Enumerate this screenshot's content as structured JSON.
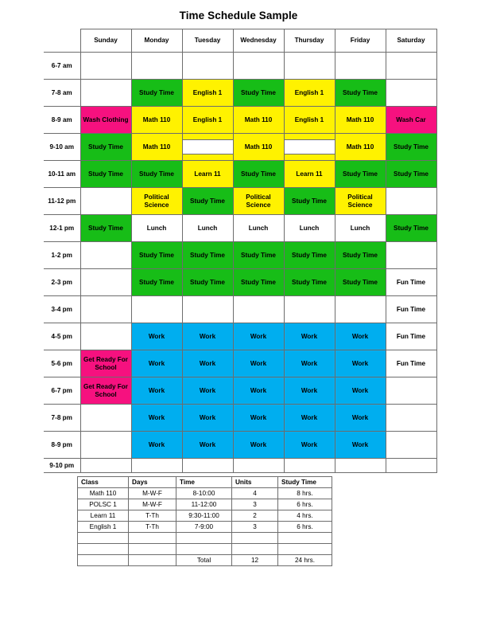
{
  "document": {
    "title": "Time Schedule Sample"
  },
  "colors": {
    "green": "#17bd17",
    "yellow": "#fff200",
    "pink": "#f6117f",
    "blue": "#00aeef",
    "white": "#ffffff",
    "border": "#6d6d6d"
  },
  "schedule": {
    "corner_label": "",
    "day_headers": [
      "Sunday",
      "Monday",
      "Tuesday",
      "Wednesday",
      "Thursday",
      "Friday",
      "Saturday"
    ],
    "time_labels": [
      "6-7 am",
      "7-8 am",
      "8-9 am",
      "9-10 am",
      "10-11 am",
      "11-12 pm",
      "12-1 pm",
      "1-2 pm",
      "2-3 pm",
      "3-4 pm",
      "4-5 pm",
      "5-6 pm",
      "6-7 pm",
      "7-8 pm",
      "8-9 pm",
      "9-10 pm"
    ],
    "rows": [
      {
        "time": "6-7 am",
        "cells": [
          {
            "text": "",
            "color": "white"
          },
          {
            "text": "",
            "color": "white"
          },
          {
            "text": "",
            "color": "white"
          },
          {
            "text": "",
            "color": "white"
          },
          {
            "text": "",
            "color": "white"
          },
          {
            "text": "",
            "color": "white"
          },
          {
            "text": "",
            "color": "white"
          }
        ]
      },
      {
        "time": "7-8 am",
        "cells": [
          {
            "text": "",
            "color": "white"
          },
          {
            "text": "Study Time",
            "color": "green"
          },
          {
            "text": "English 1",
            "color": "yellow"
          },
          {
            "text": "Study Time",
            "color": "green"
          },
          {
            "text": "English 1",
            "color": "yellow"
          },
          {
            "text": "Study Time",
            "color": "green"
          },
          {
            "text": "",
            "color": "white"
          }
        ]
      },
      {
        "time": "8-9 am",
        "cells": [
          {
            "text": "Wash Clothing",
            "color": "pink"
          },
          {
            "text": "Math 110",
            "color": "yellow"
          },
          {
            "text": "English 1",
            "color": "yellow"
          },
          {
            "text": "Math 110",
            "color": "yellow"
          },
          {
            "text": "English 1",
            "color": "yellow"
          },
          {
            "text": "Math 110",
            "color": "yellow"
          },
          {
            "text": "Wash Car",
            "color": "pink"
          }
        ]
      },
      {
        "time": "9-10 am",
        "cells": [
          {
            "text": "Study Time",
            "color": "green"
          },
          {
            "text": "Math 110",
            "color": "yellow"
          },
          {
            "text": "",
            "color": "split-yellow"
          },
          {
            "text": "Math 110",
            "color": "yellow"
          },
          {
            "text": "",
            "color": "split-yellow"
          },
          {
            "text": "Math 110",
            "color": "yellow"
          },
          {
            "text": "Study Time",
            "color": "green"
          }
        ]
      },
      {
        "time": "10-11 am",
        "cells": [
          {
            "text": "Study Time",
            "color": "green"
          },
          {
            "text": "Study Time",
            "color": "green"
          },
          {
            "text": "Learn 11",
            "color": "yellow"
          },
          {
            "text": "Study Time",
            "color": "green"
          },
          {
            "text": "Learn 11",
            "color": "yellow"
          },
          {
            "text": "Study Time",
            "color": "green"
          },
          {
            "text": "Study Time",
            "color": "green"
          }
        ]
      },
      {
        "time": "11-12 pm",
        "cells": [
          {
            "text": "",
            "color": "white"
          },
          {
            "text": "Political Science",
            "color": "yellow"
          },
          {
            "text": "Study Time",
            "color": "green"
          },
          {
            "text": "Political Science",
            "color": "yellow"
          },
          {
            "text": "Study Time",
            "color": "green"
          },
          {
            "text": "Political Science",
            "color": "yellow"
          },
          {
            "text": "",
            "color": "white"
          }
        ]
      },
      {
        "time": "12-1 pm",
        "cells": [
          {
            "text": "Study Time",
            "color": "green"
          },
          {
            "text": "Lunch",
            "color": "white"
          },
          {
            "text": "Lunch",
            "color": "white"
          },
          {
            "text": "Lunch",
            "color": "white"
          },
          {
            "text": "Lunch",
            "color": "white"
          },
          {
            "text": "Lunch",
            "color": "white"
          },
          {
            "text": "Study Time",
            "color": "green"
          }
        ]
      },
      {
        "time": "1-2 pm",
        "cells": [
          {
            "text": "",
            "color": "white"
          },
          {
            "text": "Study Time",
            "color": "green"
          },
          {
            "text": "Study Time",
            "color": "green"
          },
          {
            "text": "Study Time",
            "color": "green"
          },
          {
            "text": "Study Time",
            "color": "green"
          },
          {
            "text": "Study Time",
            "color": "green"
          },
          {
            "text": "",
            "color": "white"
          }
        ]
      },
      {
        "time": "2-3 pm",
        "cells": [
          {
            "text": "",
            "color": "white"
          },
          {
            "text": "Study Time",
            "color": "green"
          },
          {
            "text": "Study Time",
            "color": "green"
          },
          {
            "text": "Study Time",
            "color": "green"
          },
          {
            "text": "Study Time",
            "color": "green"
          },
          {
            "text": "Study Time",
            "color": "green"
          },
          {
            "text": "Fun Time",
            "color": "white"
          }
        ]
      },
      {
        "time": "3-4 pm",
        "cells": [
          {
            "text": "",
            "color": "white"
          },
          {
            "text": "",
            "color": "white"
          },
          {
            "text": "",
            "color": "white"
          },
          {
            "text": "",
            "color": "white"
          },
          {
            "text": "",
            "color": "white"
          },
          {
            "text": "",
            "color": "white"
          },
          {
            "text": "Fun Time",
            "color": "white"
          }
        ]
      },
      {
        "time": "4-5 pm",
        "cells": [
          {
            "text": "",
            "color": "white"
          },
          {
            "text": "Work",
            "color": "blue"
          },
          {
            "text": "Work",
            "color": "blue"
          },
          {
            "text": "Work",
            "color": "blue"
          },
          {
            "text": "Work",
            "color": "blue"
          },
          {
            "text": "Work",
            "color": "blue"
          },
          {
            "text": "Fun Time",
            "color": "white"
          }
        ]
      },
      {
        "time": "5-6 pm",
        "cells": [
          {
            "text": "Get Ready For School",
            "color": "pink"
          },
          {
            "text": "Work",
            "color": "blue"
          },
          {
            "text": "Work",
            "color": "blue"
          },
          {
            "text": "Work",
            "color": "blue"
          },
          {
            "text": "Work",
            "color": "blue"
          },
          {
            "text": "Work",
            "color": "blue"
          },
          {
            "text": "Fun Time",
            "color": "white"
          }
        ]
      },
      {
        "time": "6-7 pm",
        "cells": [
          {
            "text": "Get Ready For School",
            "color": "pink"
          },
          {
            "text": "Work",
            "color": "blue"
          },
          {
            "text": "Work",
            "color": "blue"
          },
          {
            "text": "Work",
            "color": "blue"
          },
          {
            "text": "Work",
            "color": "blue"
          },
          {
            "text": "Work",
            "color": "blue"
          },
          {
            "text": "",
            "color": "white"
          }
        ]
      },
      {
        "time": "7-8 pm",
        "cells": [
          {
            "text": "",
            "color": "white"
          },
          {
            "text": "Work",
            "color": "blue"
          },
          {
            "text": "Work",
            "color": "blue"
          },
          {
            "text": "Work",
            "color": "blue"
          },
          {
            "text": "Work",
            "color": "blue"
          },
          {
            "text": "Work",
            "color": "blue"
          },
          {
            "text": "",
            "color": "white"
          }
        ]
      },
      {
        "time": "8-9 pm",
        "cells": [
          {
            "text": "",
            "color": "white"
          },
          {
            "text": "Work",
            "color": "blue"
          },
          {
            "text": "Work",
            "color": "blue"
          },
          {
            "text": "Work",
            "color": "blue"
          },
          {
            "text": "Work",
            "color": "blue"
          },
          {
            "text": "Work",
            "color": "blue"
          },
          {
            "text": "",
            "color": "white"
          }
        ]
      },
      {
        "time": "9-10 pm",
        "cells": [
          {
            "text": "",
            "color": "white"
          },
          {
            "text": "",
            "color": "white"
          },
          {
            "text": "",
            "color": "white"
          },
          {
            "text": "",
            "color": "white"
          },
          {
            "text": "",
            "color": "white"
          },
          {
            "text": "",
            "color": "white"
          },
          {
            "text": "",
            "color": "white"
          }
        ]
      }
    ]
  },
  "summary": {
    "headers": [
      "Class",
      "Days",
      "Time",
      "Units",
      "Study Time"
    ],
    "rows": [
      [
        "Math 110",
        "M-W-F",
        "8-10:00",
        "4",
        "8 hrs."
      ],
      [
        "POLSC 1",
        "M-W-F",
        "11-12:00",
        "3",
        "6 hrs."
      ],
      [
        "Learn 11",
        "T-Th",
        "9:30-11:00",
        "2",
        "4 hrs."
      ],
      [
        "English 1",
        "T-Th",
        "7-9:00",
        "3",
        "6 hrs."
      ],
      [
        "",
        "",
        "",
        "",
        ""
      ],
      [
        "",
        "",
        "",
        "",
        ""
      ],
      [
        "",
        "",
        "Total",
        "12",
        "24 hrs."
      ]
    ]
  }
}
